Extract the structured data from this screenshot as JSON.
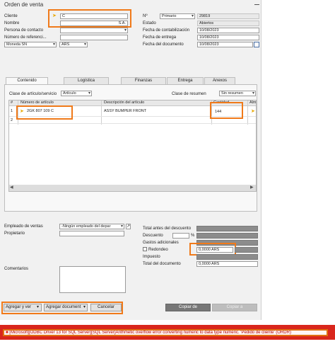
{
  "window": {
    "title": "Orden de venta"
  },
  "header_left": {
    "cliente_label": "Cliente",
    "cliente_value": "C",
    "nombre_label": "Nombre",
    "nombre_value": "S.A.",
    "contacto_label": "Persona de contacto",
    "referencia_label": "Número de referenci...",
    "moneda_select": "Moneda SN",
    "moneda_value": "ARS"
  },
  "header_right": {
    "no_label": "Nº",
    "serie_select": "Primario",
    "numero": "29819",
    "estado_label": "Estado",
    "estado_value": "Abiertos",
    "fecha_cont_label": "Fecha de contabilización",
    "fecha_cont_value": "10/08/2023",
    "fecha_entrega_label": "Fecha de entrega",
    "fecha_entrega_value": "10/08/2023",
    "fecha_doc_label": "Fecha del documento",
    "fecha_doc_value": "10/08/2023"
  },
  "tabs": [
    {
      "label": "Contenido"
    },
    {
      "label": "Logística"
    },
    {
      "label": "Finanzas"
    },
    {
      "label": "Entrega"
    },
    {
      "label": "Anexos"
    }
  ],
  "content": {
    "clase_articulo_label": "Clase de artículo/servicio",
    "clase_articulo_value": "Artículo",
    "clase_resumen_label": "Clase de resumen",
    "clase_resumen_value": "Sin resumen",
    "columns": [
      "#",
      "Número de artículo",
      "Descripción del artículo",
      "Cantidad",
      "Alm"
    ],
    "rows": [
      {
        "num": "1",
        "articulo": "2GK 807 109 C",
        "descripcion": "ASSY BUMPER FRONT",
        "cantidad": "144"
      },
      {
        "num": "2",
        "articulo": "",
        "descripcion": "",
        "cantidad": ""
      }
    ]
  },
  "footer_left": {
    "empleado_label": "Empleado de ventas",
    "empleado_value": "-Ningún empleado del depar",
    "propietario_label": "Propietario",
    "comentarios_label": "Comentarios"
  },
  "totals": {
    "total_antes_label": "Total antes del descuento",
    "descuento_label": "Descuento",
    "percent_sign": "%",
    "gastos_label": "Gastos adicionales",
    "redondeo_label": "Redondeo",
    "redondeo_value": "0,0000 ARS",
    "impuesto_label": "Impuesto",
    "total_doc_label": "Total del documento",
    "total_doc_value": "0,0000 ARS"
  },
  "buttons": {
    "agregar_y_ver": "Agregar y ver",
    "agregar_documento": "Agregar document",
    "cancelar": "Cancelar",
    "copiar_de": "Copiar de",
    "copiar_a": "Copiar a"
  },
  "error": {
    "message": "[Microsoft][ODBC Driver 13 for SQL Server][SQL Server]Arithmetic overflow error converting numeric to data type numeric. 'Pedido de cliente' (ORDR)"
  },
  "colors": {
    "highlight": "#f07a1a",
    "error_bar": "#d9261c",
    "link_arrow": "#e8a800"
  }
}
